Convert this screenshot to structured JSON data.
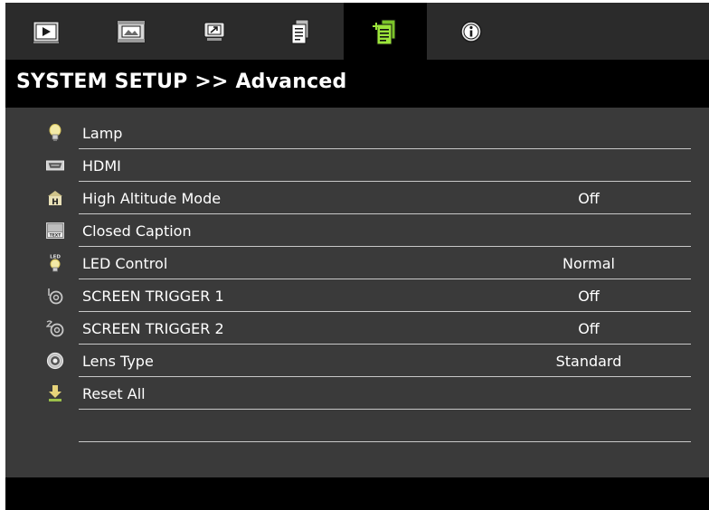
{
  "header": {
    "tabs": [
      {
        "icon": "image-icon"
      },
      {
        "icon": "display-icon"
      },
      {
        "icon": "setup-icon"
      },
      {
        "icon": "document-icon"
      },
      {
        "icon": "advanced-setup-icon"
      },
      {
        "icon": "info-icon"
      }
    ],
    "active_tab": 4
  },
  "title": "SYSTEM SETUP >> Advanced",
  "menu": {
    "items": [
      {
        "label": "Lamp",
        "value": "",
        "icon": "lamp-icon"
      },
      {
        "label": "HDMI",
        "value": "",
        "icon": "hdmi-icon"
      },
      {
        "label": "High Altitude Mode",
        "value": "Off",
        "icon": "high-altitude-icon"
      },
      {
        "label": "Closed Caption",
        "value": "",
        "icon": "closed-caption-icon"
      },
      {
        "label": "LED Control",
        "value": "Normal",
        "icon": "led-icon"
      },
      {
        "label": "SCREEN TRIGGER 1",
        "value": "Off",
        "icon": "screen-trigger-1-icon"
      },
      {
        "label": "SCREEN TRIGGER 2",
        "value": "Off",
        "icon": "screen-trigger-2-icon"
      },
      {
        "label": "Lens Type",
        "value": "Standard",
        "icon": "lens-icon"
      },
      {
        "label": "Reset All",
        "value": "",
        "icon": "reset-icon"
      }
    ]
  },
  "colors": {
    "background": "#3a3a3a",
    "title_bar": "#000000",
    "active_tab": "#000000",
    "accent_green": "#9be33a",
    "text": "#ffffff"
  }
}
